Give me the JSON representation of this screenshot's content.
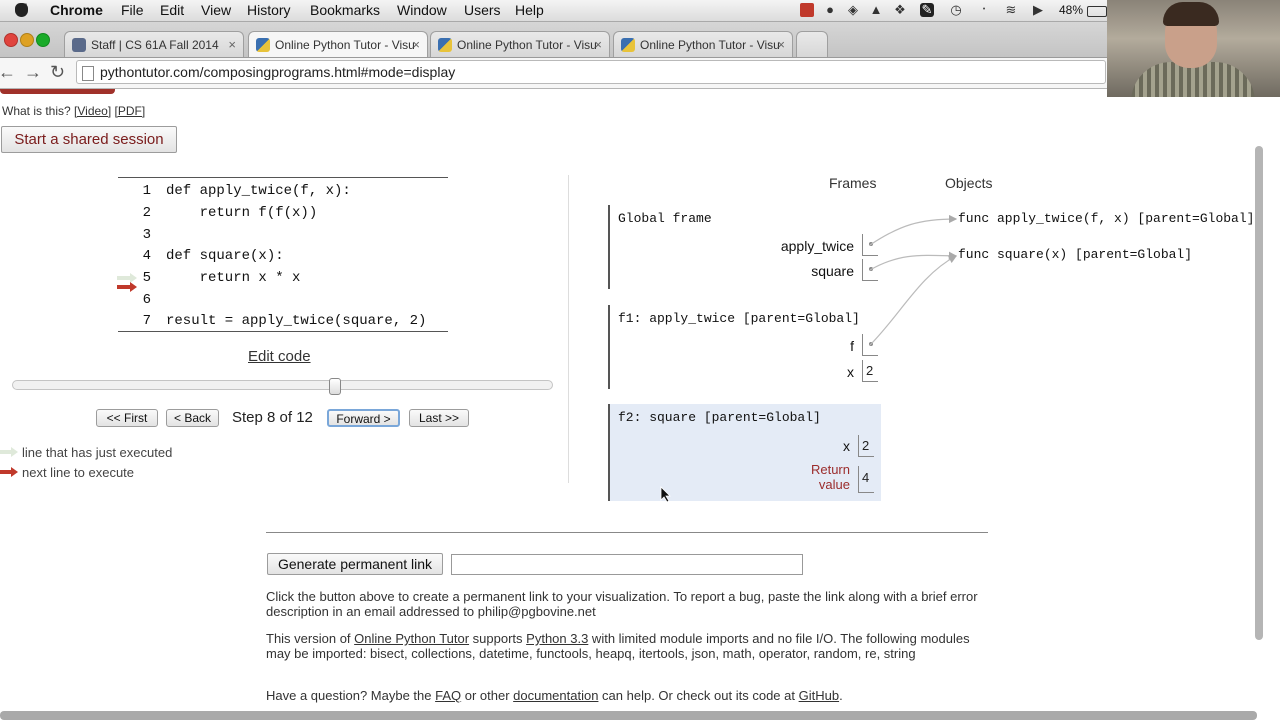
{
  "menubar": {
    "app": "Chrome",
    "items": [
      "File",
      "Edit",
      "View",
      "History",
      "Bookmarks",
      "Window",
      "Users",
      "Help"
    ],
    "battery": "48%"
  },
  "tabs": [
    {
      "label": "Staff | CS 61A Fall 2014",
      "favicon_color": "#5a6a8a"
    },
    {
      "label": "Online Python Tutor - Visu",
      "favicon_color": "#e8c33a"
    },
    {
      "label": "Online Python Tutor - Visu",
      "favicon_color": "#e8c33a"
    },
    {
      "label": "Online Python Tutor - Visu",
      "favicon_color": "#e8c33a"
    }
  ],
  "address": {
    "url": "pythontutor.com/composingprograms.html#mode=display"
  },
  "help": {
    "prefix": "What is this?",
    "video": "[Video]",
    "pdf": "[PDF]"
  },
  "shared_session_label": "Start a shared session",
  "code": {
    "lines": [
      {
        "num": "1",
        "text": "def apply_twice(f, x):"
      },
      {
        "num": "2",
        "text": "    return f(f(x))"
      },
      {
        "num": "3",
        "text": ""
      },
      {
        "num": "4",
        "text": "def square(x):"
      },
      {
        "num": "5",
        "text": "    return x * x"
      },
      {
        "num": "6",
        "text": ""
      },
      {
        "num": "7",
        "text": "result = apply_twice(square, 2)"
      }
    ],
    "edit_label": "Edit code"
  },
  "navigation": {
    "first": "<< First",
    "back": "< Back",
    "step": "Step 8 of 12",
    "forward": "Forward >",
    "last": "Last >>",
    "progress_fraction": 0.6
  },
  "legend": {
    "executed": "line that has just executed",
    "next": "next line to execute",
    "arrow_color": "#c0392b",
    "executed_color": "#c8e6c0"
  },
  "viz": {
    "frames_header": "Frames",
    "objects_header": "Objects",
    "global_frame": {
      "title": "Global frame",
      "vars": [
        {
          "name": "apply_twice"
        },
        {
          "name": "square"
        }
      ]
    },
    "f1": {
      "title": "f1: apply_twice [parent=Global]",
      "vars": [
        {
          "name": "f",
          "value": ""
        },
        {
          "name": "x",
          "value": "2"
        }
      ]
    },
    "f2": {
      "title": "f2: square [parent=Global]",
      "x_name": "x",
      "x_value": "2",
      "return_label_1": "Return",
      "return_label_2": "value",
      "return_value": "4",
      "bg_color": "#e4ebf6"
    },
    "objects": [
      {
        "text": "func apply_twice(f, x) [parent=Global]"
      },
      {
        "text": "func square(x) [parent=Global]"
      }
    ]
  },
  "permalink": {
    "button": "Generate permanent link",
    "value": ""
  },
  "info": {
    "p1": "Click the button above to create a permanent link to your visualization. To report a bug, paste the link along with a brief error description in an email addressed to philip@pgbovine.net",
    "p2_a": "This version of ",
    "p2_link1": "Online Python Tutor",
    "p2_b": " supports ",
    "p2_link2": "Python 3.3",
    "p2_c": " with limited module imports and no file I/O. The following modules may be imported: bisect, collections, datetime, functools, heapq, itertools, json, math, operator, random, re, string",
    "p3_a": "Have a question? Maybe the ",
    "p3_faq": "FAQ",
    "p3_b": " or other ",
    "p3_doc": "documentation",
    "p3_c": " can help. Or check out its code at ",
    "p3_gh": "GitHub",
    "p3_d": "."
  }
}
